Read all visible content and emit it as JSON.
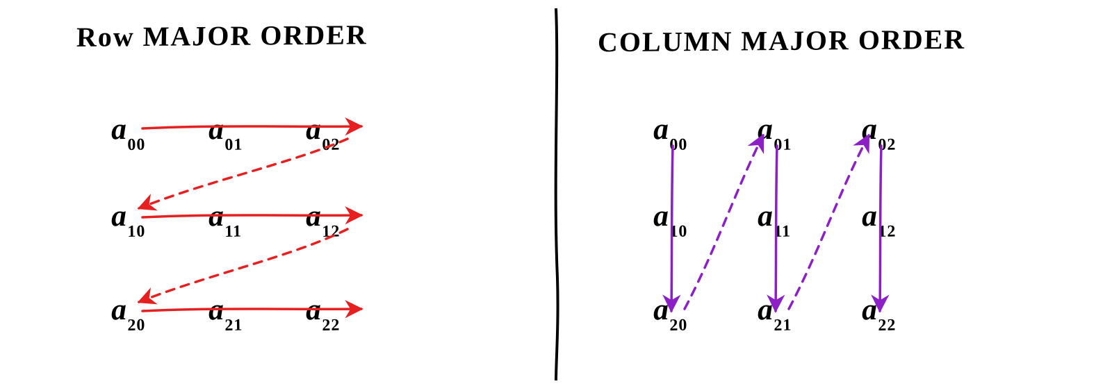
{
  "left": {
    "title": "Row MAJOR ORDER",
    "arrow_color": "#e62020",
    "matrix": [
      [
        {
          "sym": "a",
          "sub": "00"
        },
        {
          "sym": "a",
          "sub": "01"
        },
        {
          "sym": "a",
          "sub": "02"
        }
      ],
      [
        {
          "sym": "a",
          "sub": "10"
        },
        {
          "sym": "a",
          "sub": "11"
        },
        {
          "sym": "a",
          "sub": "12"
        }
      ],
      [
        {
          "sym": "a",
          "sub": "20"
        },
        {
          "sym": "a",
          "sub": "21"
        },
        {
          "sym": "a",
          "sub": "22"
        }
      ]
    ]
  },
  "right": {
    "title": "COLUMN MAJOR ORDER",
    "arrow_color": "#8c1fc5",
    "matrix": [
      [
        {
          "sym": "a",
          "sub": "00"
        },
        {
          "sym": "a",
          "sub": "01"
        },
        {
          "sym": "a",
          "sub": "02"
        }
      ],
      [
        {
          "sym": "a",
          "sub": "10"
        },
        {
          "sym": "a",
          "sub": "11"
        },
        {
          "sym": "a",
          "sub": "12"
        }
      ],
      [
        {
          "sym": "a",
          "sub": "20"
        },
        {
          "sym": "a",
          "sub": "21"
        },
        {
          "sym": "a",
          "sub": "22"
        }
      ]
    ]
  }
}
